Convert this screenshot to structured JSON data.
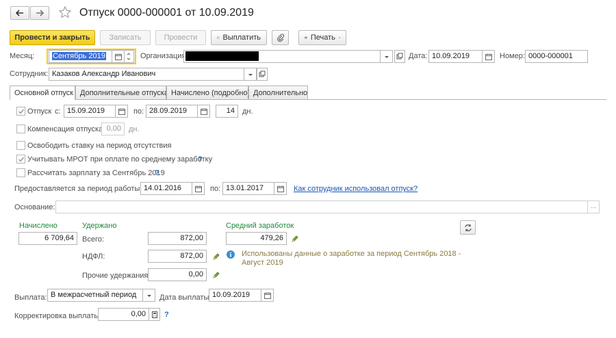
{
  "header": {
    "title": "Отпуск 0000-000001 от 10.09.2019"
  },
  "toolbar": {
    "post_close": "Провести и закрыть",
    "save": "Записать",
    "post": "Провести",
    "pay": "Выплатить",
    "print": "Печать"
  },
  "top_fields": {
    "month_label": "Месяц:",
    "month_value": "Сентябрь 2019",
    "org_label": "Организация:",
    "org_value": "",
    "date_label": "Дата:",
    "date_value": "10.09.2019",
    "number_label": "Номер:",
    "number_value": "0000-000001",
    "employee_label": "Сотрудник:",
    "employee_value": "Казаков Александр Иванович"
  },
  "tabs": [
    {
      "label": "Основной отпуск"
    },
    {
      "label": "Дополнительные отпуска"
    },
    {
      "label": "Начислено (подробно)"
    },
    {
      "label": "Дополнительно"
    }
  ],
  "vacation": {
    "label": "Отпуск",
    "from_label": "с:",
    "from": "15.09.2019",
    "to_label": "по:",
    "to": "28.09.2019",
    "days": "14",
    "days_unit": "дн."
  },
  "compensation": {
    "label": "Компенсация отпуска",
    "value": "0,00",
    "unit": "дн."
  },
  "options": {
    "free_rate": "Освободить ставку на период отсутствия",
    "mrot": "Учитывать МРОТ при оплате по среднему заработку",
    "help": "?",
    "calc_salary": "Рассчитать зарплату за Сентябрь 2019"
  },
  "period": {
    "label": "Предоставляется за период работы с:",
    "from": "14.01.2016",
    "to_label": "по:",
    "to": "13.01.2017",
    "link": "Как сотрудник использовал отпуск?"
  },
  "basis": {
    "label": "Основание:",
    "value": "",
    "btn": "..."
  },
  "totals": {
    "accrued_label": "Начислено",
    "accrued_value": "6 709,64",
    "withheld_label": "Удержано",
    "total_label": "Всего:",
    "total_value": "872,00",
    "ndfl_label": "НДФЛ:",
    "ndfl_value": "872,00",
    "other_label": "Прочие удержания:",
    "other_value": "0,00",
    "avg_label": "Средний заработок",
    "avg_value": "479,26",
    "info_text_1": "Использованы данные о заработке за период Сентябрь 2018 -",
    "info_text_2": "Август 2019"
  },
  "payout": {
    "label": "Выплата:",
    "value": "В межрасчетный период",
    "date_label": "Дата выплаты:",
    "date_value": "10.09.2019",
    "correction_label": "Корректировка выплаты:",
    "correction_value": "0,00"
  },
  "colors": {
    "primary_button": "#f2cb1b",
    "accent_green": "#1e8a3a",
    "link_blue": "#1a55b5",
    "help_blue": "#1f72c1"
  }
}
